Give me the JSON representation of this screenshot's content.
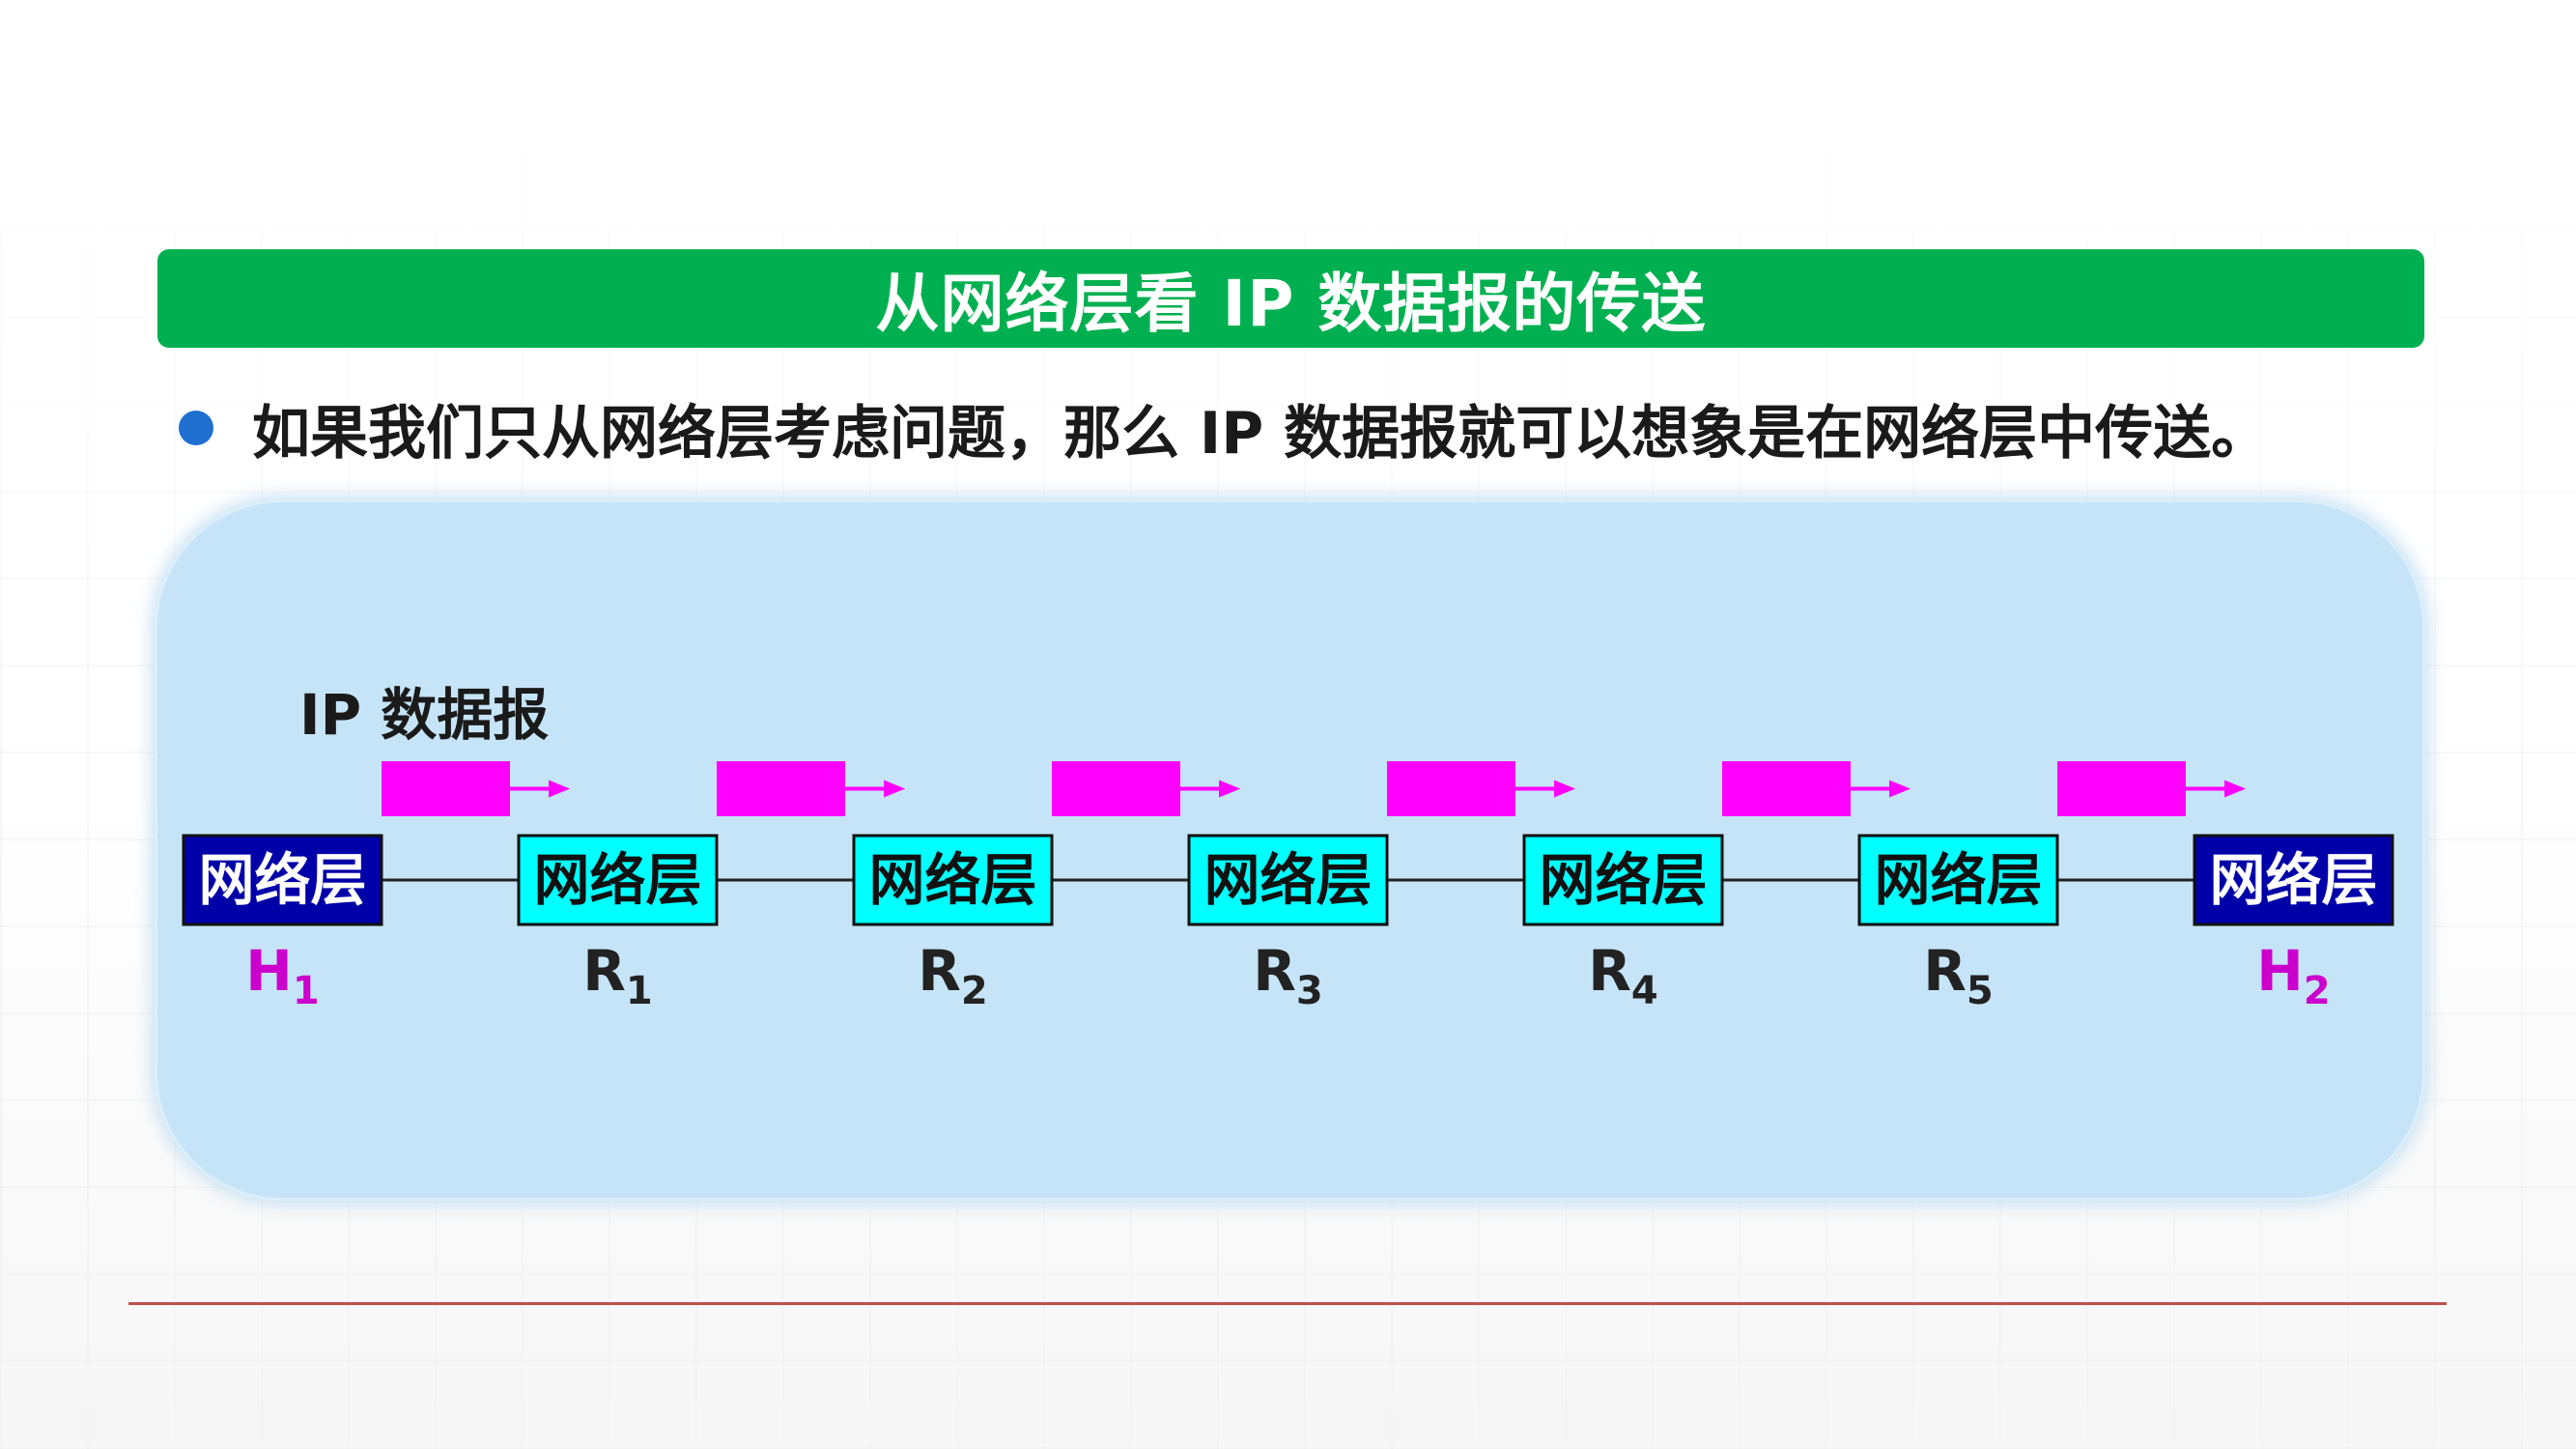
{
  "title": "从网络层看 IP 数据报的传送",
  "bullet": "如果我们只从网络层考虑问题，那么 IP 数据报就可以想象是在网络层中传送。",
  "datagram_label": "IP 数据报",
  "nodes": [
    {
      "box": "网络层",
      "name": "H",
      "sub": "1",
      "kind": "host"
    },
    {
      "box": "网络层",
      "name": "R",
      "sub": "1",
      "kind": "router"
    },
    {
      "box": "网络层",
      "name": "R",
      "sub": "2",
      "kind": "router"
    },
    {
      "box": "网络层",
      "name": "R",
      "sub": "3",
      "kind": "router"
    },
    {
      "box": "网络层",
      "name": "R",
      "sub": "4",
      "kind": "router"
    },
    {
      "box": "网络层",
      "name": "R",
      "sub": "5",
      "kind": "router"
    },
    {
      "box": "网络层",
      "name": "H",
      "sub": "2",
      "kind": "host"
    }
  ],
  "colors": {
    "title_bg": "#00b050",
    "host_box": "#0000a8",
    "router_box": "#00ffff",
    "packet": "#ff00ff",
    "host_label": "#cc00cc",
    "router_label": "#222222",
    "panel_bg": "#c6e4f7"
  }
}
